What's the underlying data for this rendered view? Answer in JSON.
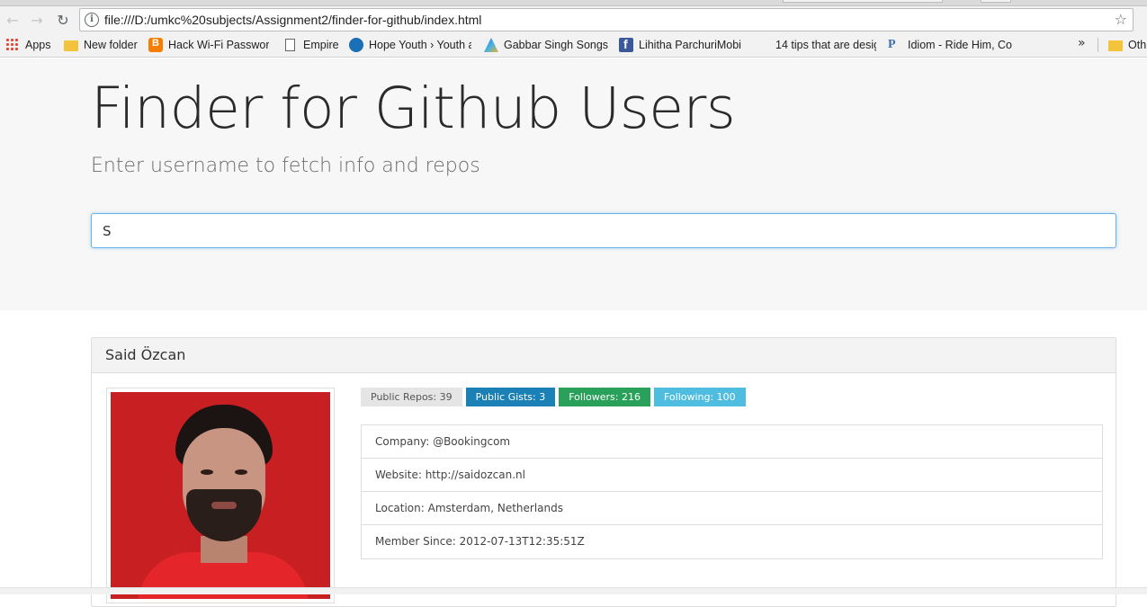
{
  "browser": {
    "url": "file:///D:/umkc%20subjects/Assignment2/finder-for-github/index.html",
    "bookmarks": [
      {
        "label": "Apps",
        "icon": "apps-grid-icon"
      },
      {
        "label": "New folder",
        "icon": "folder-icon"
      },
      {
        "label": "Hack Wi-Fi Password",
        "icon": "blogger-icon"
      },
      {
        "label": "Empire",
        "icon": "page-icon"
      },
      {
        "label": "Hope Youth › Youth a",
        "icon": "hope-icon"
      },
      {
        "label": "Gabbar Singh Songs",
        "icon": "gabbar-icon"
      },
      {
        "label": "Lihitha ParchuriMobil",
        "icon": "facebook-icon"
      },
      {
        "label": "14 tips that are desig",
        "icon": "blank-icon"
      },
      {
        "label": "Idiom - Ride Him, Co",
        "icon": "idiom-icon"
      },
      {
        "label": "Oth",
        "icon": "folder-icon"
      }
    ]
  },
  "header": {
    "title": "Finder for Github Users",
    "subtitle": "Enter username to fetch info and repos"
  },
  "search": {
    "value": "S"
  },
  "profile": {
    "name": "Said Özcan",
    "badges": {
      "public_repos": "Public Repos: 39",
      "public_gists": "Public Gists: 3",
      "followers": "Followers: 216",
      "following": "Following: 100"
    },
    "details": {
      "company": "Company: @Bookingcom",
      "website": "Website: http://saidozcan.nl",
      "location": "Location: Amsterdam, Netherlands",
      "member_since": "Member Since: 2012-07-13T12:35:51Z"
    }
  }
}
